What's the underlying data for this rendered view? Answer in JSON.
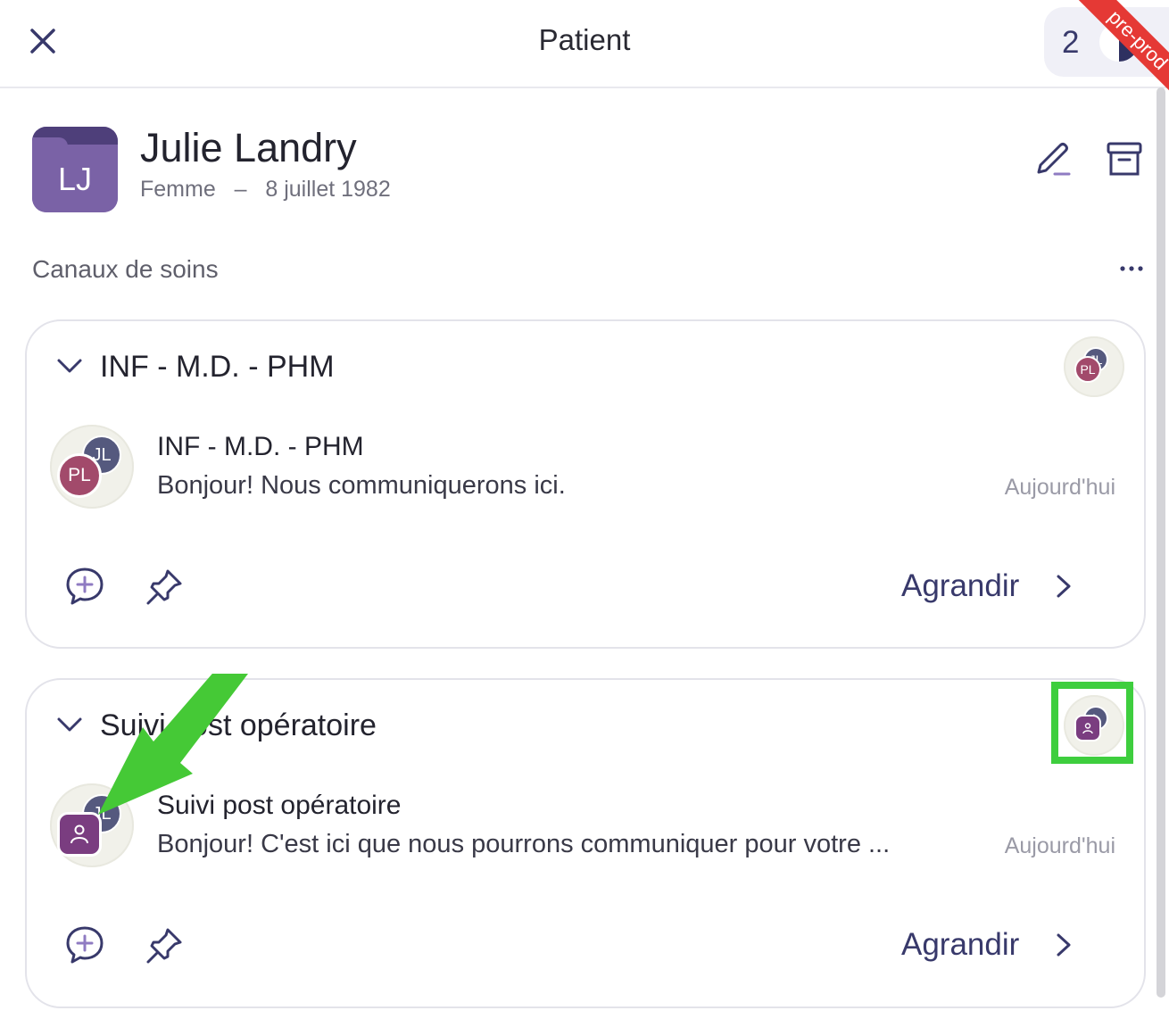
{
  "header": {
    "title": "Patient",
    "count": "2",
    "env_ribbon": "pre-prod"
  },
  "patient": {
    "initials": "LJ",
    "name": "Julie Landry",
    "gender": "Femme",
    "separator": "–",
    "birthdate": "8 juillet 1982"
  },
  "channels_section": {
    "title": "Canaux de soins",
    "more_label": "..."
  },
  "channels": [
    {
      "title": "INF - M.D. - PHM",
      "small_avatars": [
        "JL",
        "PL"
      ],
      "thread": {
        "avatars": [
          "JL",
          "PL"
        ],
        "title": "INF - M.D. - PHM",
        "preview": "Bonjour! Nous communiquerons ici.",
        "date": "Aujourd'hui"
      },
      "expand_label": "Agrandir"
    },
    {
      "title": "Suivi post opératoire",
      "small_avatars": [
        "L",
        "group"
      ],
      "thread": {
        "avatars": [
          "JL",
          "group"
        ],
        "title": "Suivi post opératoire",
        "preview": "Bonjour! C'est ici que nous pourrons communiquer pour votre ...",
        "date": "Aujourd'hui"
      },
      "expand_label": "Agrandir"
    }
  ],
  "colors": {
    "accent": "#38396b",
    "avatar_purple": "#7a62a6",
    "avatar_pink": "#a24a6b",
    "avatar_slate": "#55597e",
    "highlight_green": "#3ece3e",
    "ribbon_red": "#e53935"
  },
  "icons": {
    "close": "close-icon",
    "edit": "pencil-icon",
    "archive": "archive-icon",
    "more": "more-horizontal-icon",
    "chevron_down": "chevron-down-icon",
    "chevron_right": "chevron-right-icon",
    "new_message": "chat-plus-icon",
    "pin": "pin-icon",
    "group": "group-icon"
  }
}
